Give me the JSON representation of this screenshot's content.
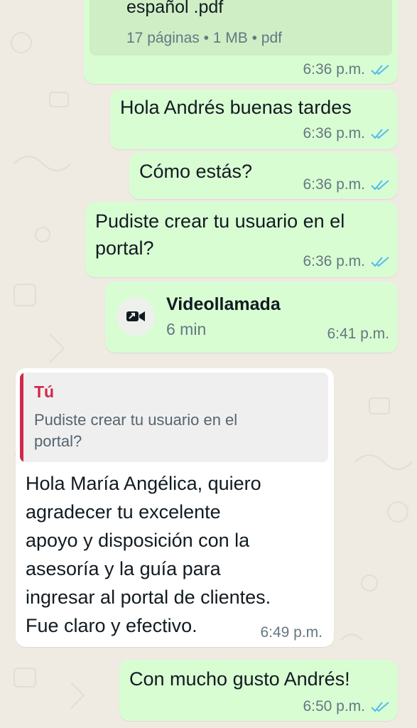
{
  "colors": {
    "outgoing_bubble": "#d9fdd3",
    "incoming_bubble": "#ffffff",
    "read_ticks": "#53bdeb",
    "quote_accent": "#d3264b",
    "wallpaper": "#efeae2"
  },
  "messages": [
    {
      "type": "document",
      "direction": "outgoing",
      "file_name_partial": "español .pdf",
      "file_info": "17 páginas • 1 MB • pdf",
      "time": "6:36 p.m.",
      "status_icon": "double-check-read-icon"
    },
    {
      "type": "text",
      "direction": "outgoing",
      "text": "Hola Andrés buenas tardes",
      "time": "6:36 p.m.",
      "status_icon": "double-check-read-icon"
    },
    {
      "type": "text",
      "direction": "outgoing",
      "text": "Cómo estás?",
      "time": "6:36 p.m.",
      "status_icon": "double-check-read-icon"
    },
    {
      "type": "text",
      "direction": "outgoing",
      "text": "Pudiste crear tu usuario en el\nportal?",
      "time": "6:36 p.m.",
      "status_icon": "double-check-read-icon"
    },
    {
      "type": "call",
      "direction": "outgoing",
      "icon": "video-call-icon",
      "title": "Videollamada",
      "duration": "6 min",
      "time": "6:41 p.m."
    },
    {
      "type": "reply",
      "direction": "incoming",
      "quote_author": "Tú",
      "quote_text": "Pudiste crear tu usuario en el\nportal?",
      "text": "Hola María Angélica, quiero\nagradecer tu excelente\napoyo y disposición con la\nasesoría y la guía para\ningresar al portal de clientes.\nFue claro y efectivo.",
      "time": "6:49 p.m."
    },
    {
      "type": "text",
      "direction": "outgoing",
      "text": "Con mucho gusto Andrés!",
      "time": "6:50 p.m.",
      "status_icon": "double-check-read-icon"
    }
  ]
}
